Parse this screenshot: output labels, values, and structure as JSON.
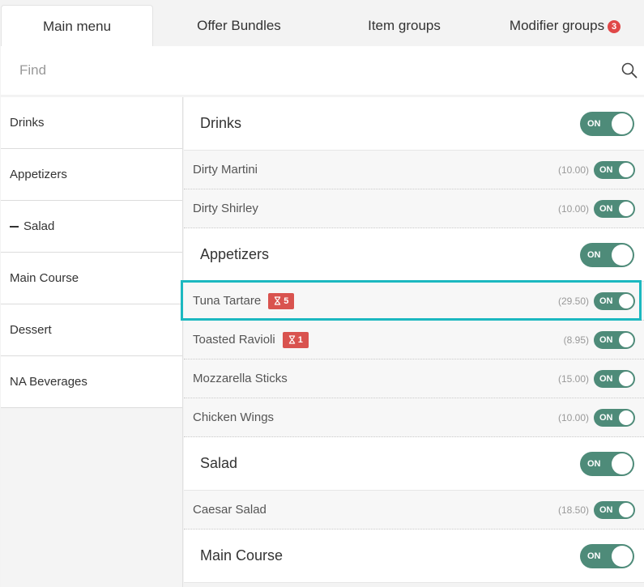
{
  "tabs": [
    {
      "label": "Main menu",
      "active": true
    },
    {
      "label": "Offer Bundles"
    },
    {
      "label": "Item groups"
    },
    {
      "label": "Modifier groups",
      "badge": "3"
    }
  ],
  "search": {
    "placeholder": "Find",
    "value": ""
  },
  "sidebar": {
    "items": [
      {
        "label": "Drinks"
      },
      {
        "label": "Appetizers"
      },
      {
        "label": "Salad",
        "prefix": "dash"
      },
      {
        "label": "Main Course"
      },
      {
        "label": "Dessert"
      },
      {
        "label": "NA Beverages"
      }
    ]
  },
  "toggle_on_label": "ON",
  "colors": {
    "toggle_on": "#4e8b79",
    "badge": "#d9534f",
    "highlight": "#1cb8c0"
  },
  "categories": [
    {
      "title": "Drinks",
      "items": [
        {
          "name": "Dirty Martini",
          "price": "(10.00)"
        },
        {
          "name": "Dirty Shirley",
          "price": "(10.00)"
        }
      ]
    },
    {
      "title": "Appetizers",
      "items": [
        {
          "name": "Tuna Tartare",
          "badge": "5",
          "price": "(29.50)"
        },
        {
          "name": "Toasted Ravioli",
          "badge": "1",
          "price": "(8.95)"
        },
        {
          "name": "Mozzarella Sticks",
          "price": "(15.00)"
        },
        {
          "name": "Chicken Wings",
          "price": "(10.00)"
        }
      ]
    },
    {
      "title": "Salad",
      "items": [
        {
          "name": "Caesar Salad",
          "price": "(18.50)"
        }
      ]
    },
    {
      "title": "Main Course",
      "items": []
    }
  ]
}
